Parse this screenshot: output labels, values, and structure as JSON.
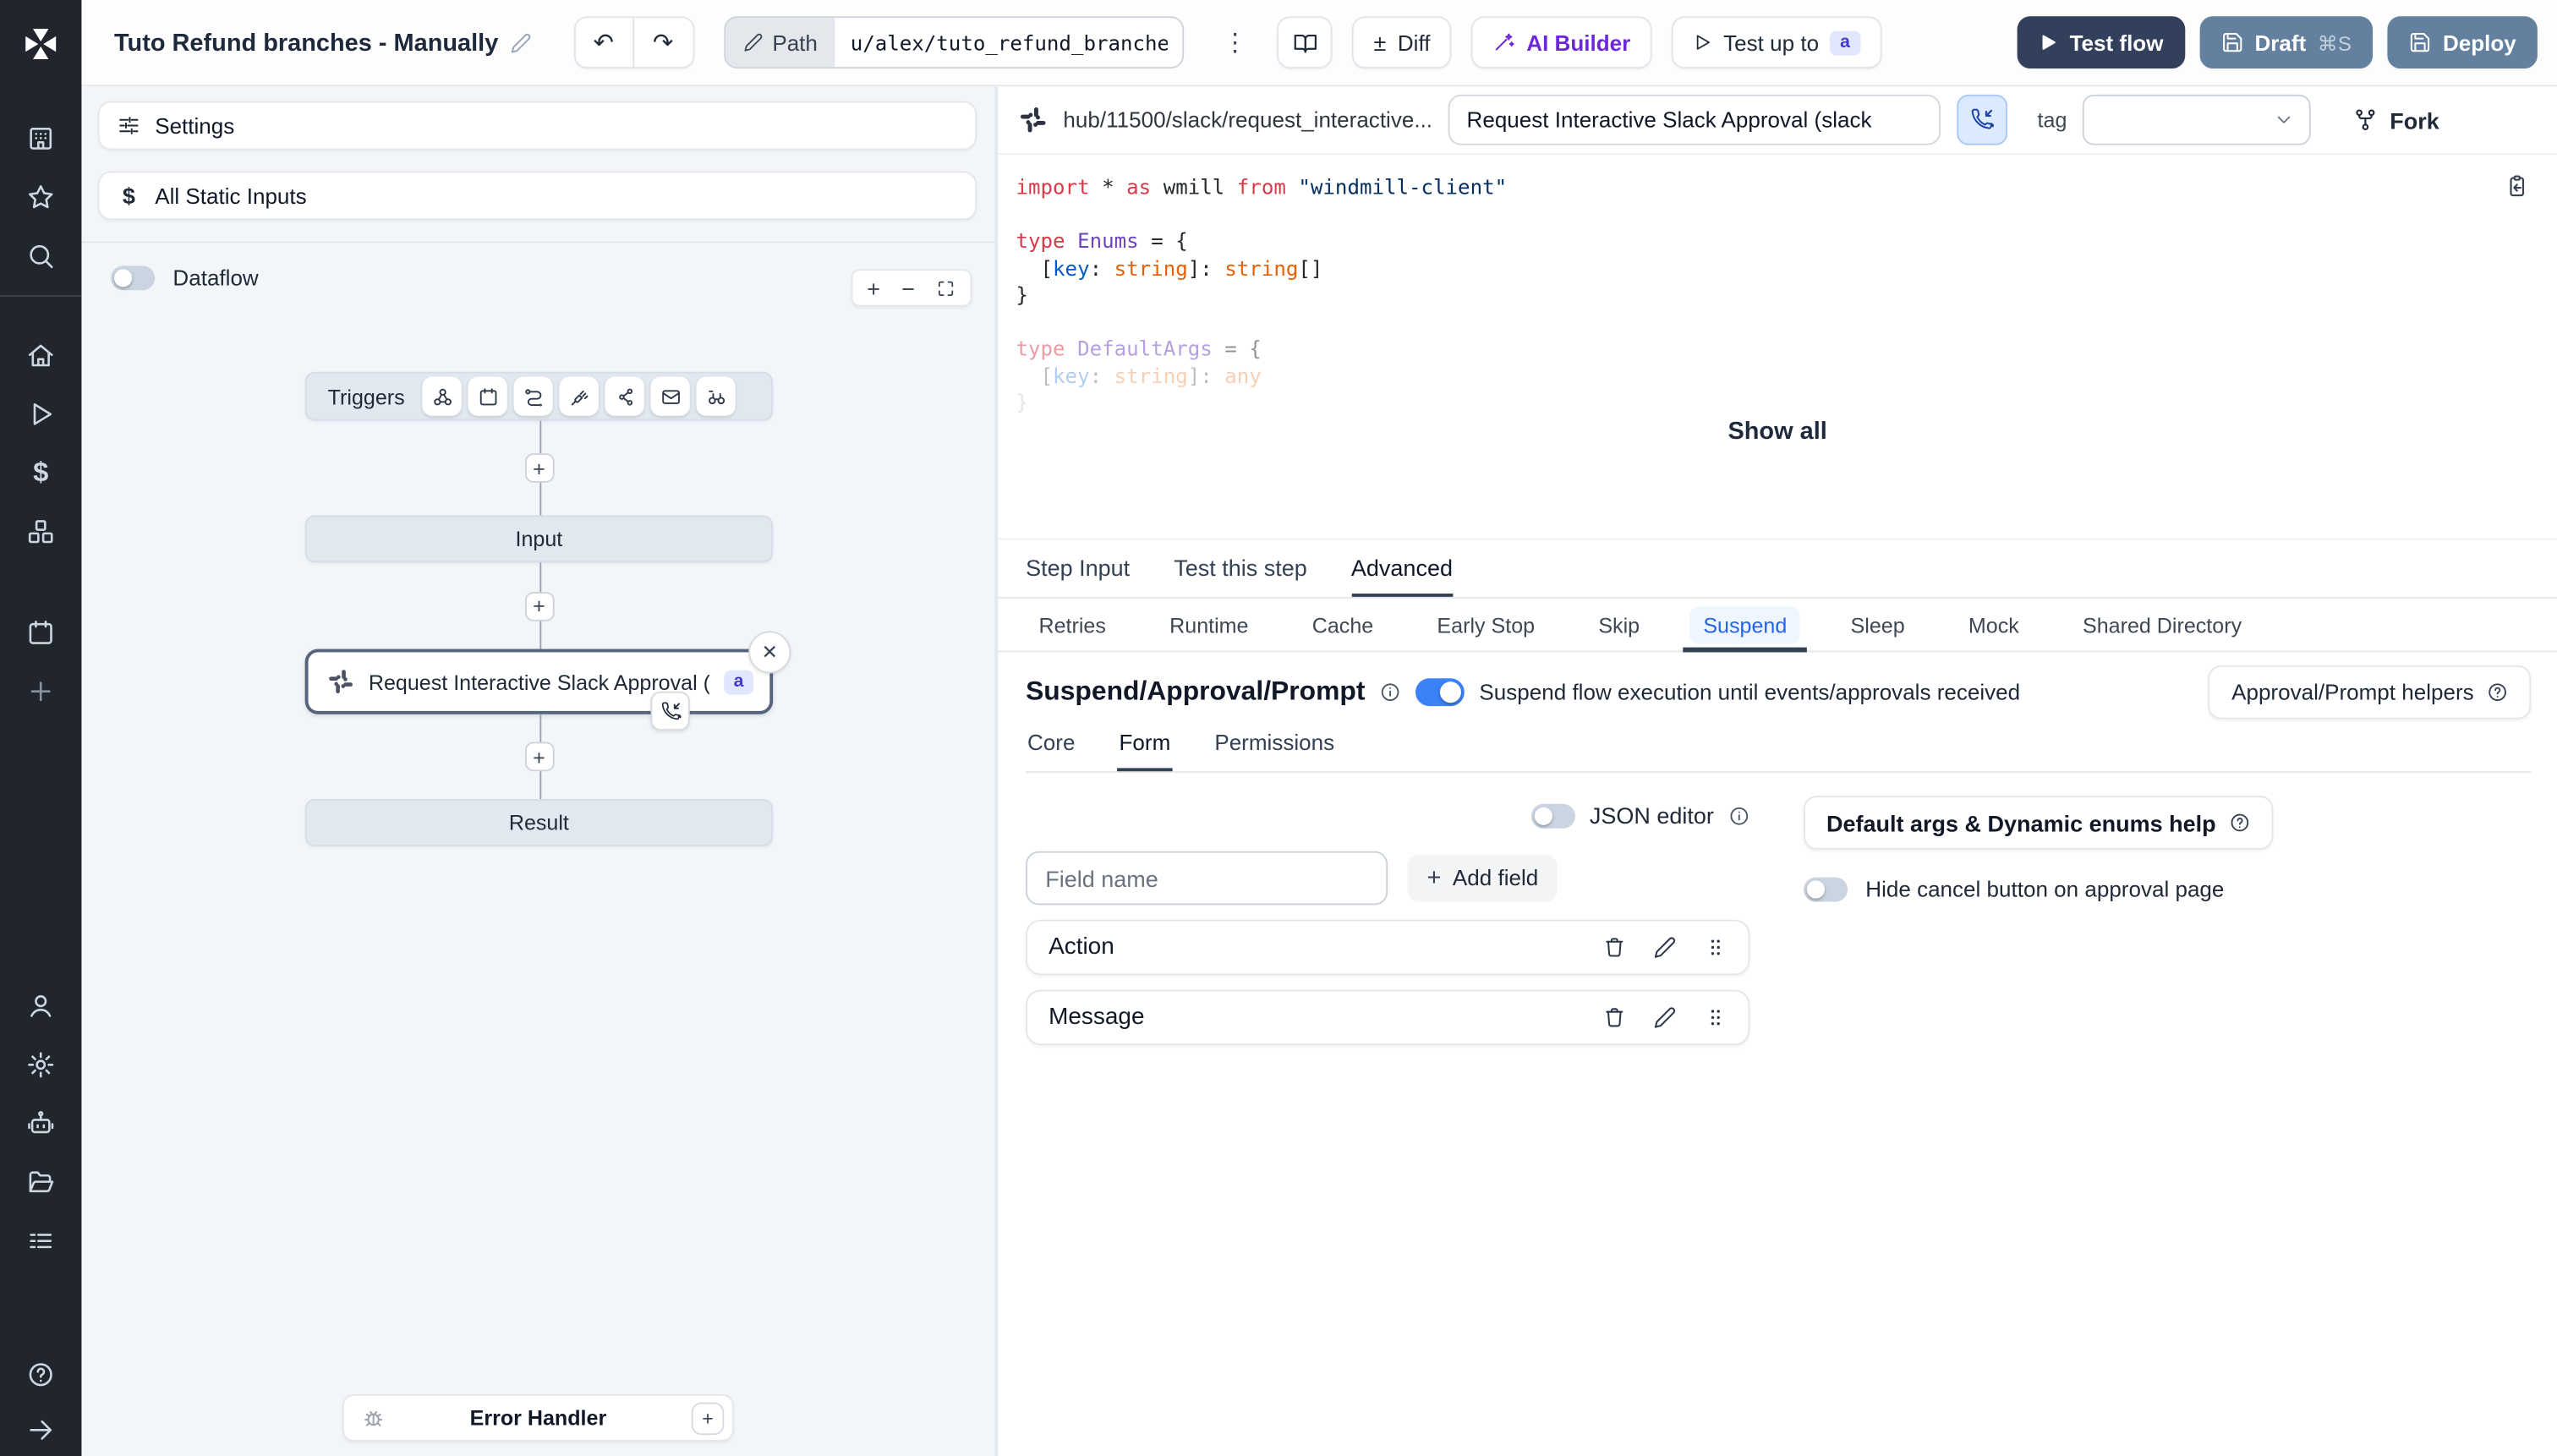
{
  "colors": {
    "accent_blue": "#3b82f6",
    "active_subtab_blue": "#2563eb",
    "test_flow_navy": "#32405c",
    "deploy_slate": "#64809f",
    "ai_builder_purple": "#6d28d9",
    "badge_indigo_bg": "#e0e7ff",
    "badge_indigo_text": "#4338ca",
    "sidebar_bg": "#21252e",
    "node_gray": "#e2e8f0"
  },
  "topbar": {
    "title": "Tuto Refund branches - Manually",
    "path_label": "Path",
    "path_value": "u/alex/tuto_refund_branches__",
    "diff_label": "Diff",
    "ai_builder_label": "AI Builder",
    "test_up_to_label": "Test up to",
    "test_up_to_badge": "a",
    "test_flow_label": "Test flow",
    "draft_label": "Draft",
    "draft_shortcut": "⌘S",
    "deploy_label": "Deploy"
  },
  "left_panel": {
    "settings_label": "Settings",
    "static_inputs_label": "All Static Inputs",
    "dataflow_label": "Dataflow",
    "graph": {
      "triggers_label": "Triggers",
      "input_label": "Input",
      "step_label": "Request Interactive Slack Approval (...",
      "step_badge": "a",
      "result_label": "Result",
      "error_handler_label": "Error Handler"
    }
  },
  "right_panel": {
    "header": {
      "hub_path": "hub/11500/slack/request_interactive...",
      "summary_value": "Request Interactive Slack Approval (slack",
      "tag_label": "tag",
      "fork_label": "Fork"
    },
    "code": {
      "show_all_label": "Show all",
      "lines": [
        {
          "opacity": 1,
          "tokens": [
            [
              "kw",
              "import"
            ],
            [
              "pl",
              " * "
            ],
            [
              "kw",
              "as"
            ],
            [
              "pl",
              " wmill "
            ],
            [
              "kw",
              "from"
            ],
            [
              "pl",
              " "
            ],
            [
              "str",
              "\"windmill-client\""
            ]
          ]
        },
        {
          "opacity": 1,
          "tokens": []
        },
        {
          "opacity": 1,
          "tokens": [
            [
              "kw",
              "type"
            ],
            [
              "pl",
              " "
            ],
            [
              "type",
              "Enums"
            ],
            [
              "pl",
              " = {"
            ]
          ]
        },
        {
          "opacity": 1,
          "tokens": [
            [
              "pl",
              "  ["
            ],
            [
              "prop",
              "key"
            ],
            [
              "pl",
              ": "
            ],
            [
              "orange",
              "string"
            ],
            [
              "pl",
              "]: "
            ],
            [
              "orange",
              "string"
            ],
            [
              "pl",
              "[]"
            ]
          ]
        },
        {
          "opacity": 1,
          "tokens": [
            [
              "pl",
              "}"
            ]
          ]
        },
        {
          "opacity": 1,
          "tokens": []
        },
        {
          "opacity": 0.5,
          "tokens": [
            [
              "kw",
              "type"
            ],
            [
              "pl",
              " "
            ],
            [
              "type",
              "DefaultArgs"
            ],
            [
              "pl",
              " = {"
            ]
          ]
        },
        {
          "opacity": 0.3,
          "tokens": [
            [
              "pl",
              "  ["
            ],
            [
              "prop",
              "key"
            ],
            [
              "pl",
              ": "
            ],
            [
              "orange",
              "string"
            ],
            [
              "pl",
              "]: "
            ],
            [
              "orange",
              "any"
            ]
          ]
        },
        {
          "opacity": 0.12,
          "tokens": [
            [
              "pl",
              "}"
            ]
          ]
        }
      ]
    },
    "tabs": {
      "items": [
        "Step Input",
        "Test this step",
        "Advanced"
      ],
      "active": 2
    },
    "subtabs": {
      "items": [
        "Retries",
        "Runtime",
        "Cache",
        "Early Stop",
        "Skip",
        "Suspend",
        "Sleep",
        "Mock",
        "Shared Directory"
      ],
      "active": 5
    },
    "suspend": {
      "title": "Suspend/Approval/Prompt",
      "toggle_on": true,
      "toggle_text": "Suspend flow execution until events/approvals received",
      "helpers_label": "Approval/Prompt helpers",
      "inner_tabs": {
        "items": [
          "Core",
          "Form",
          "Permissions"
        ],
        "active": 1
      },
      "json_editor_label": "JSON editor",
      "field_name_placeholder": "Field name",
      "add_field_label": "Add field",
      "default_args_help_label": "Default args & Dynamic enums help",
      "hide_cancel_label": "Hide cancel button on approval page",
      "fields": [
        "Action",
        "Message"
      ]
    }
  }
}
